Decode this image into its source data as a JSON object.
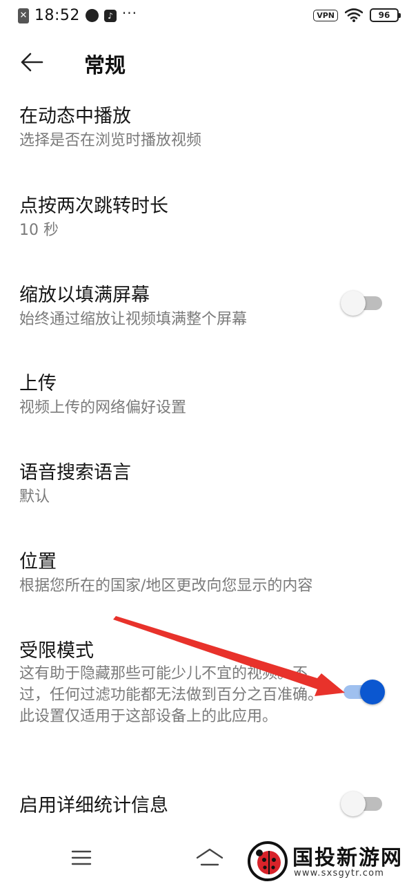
{
  "status_bar": {
    "notif_icon": "x-badge-icon",
    "time": "18:52",
    "more": "···",
    "vpn": "VPN",
    "battery": "96"
  },
  "header": {
    "back_icon": "arrow-left-icon",
    "title": "常规"
  },
  "settings": [
    {
      "title": "在动态中播放",
      "subtitle": "选择是否在浏览时播放视频",
      "toggle": null
    },
    {
      "title": "点按两次跳转时长",
      "subtitle": "10 秒",
      "toggle": null
    },
    {
      "title": "缩放以填满屏幕",
      "subtitle": "始终通过缩放让视频填满整个屏幕",
      "toggle": "off"
    },
    {
      "title": "上传",
      "subtitle": "视频上传的网络偏好设置",
      "toggle": null
    },
    {
      "title": "语音搜索语言",
      "subtitle": "默认",
      "toggle": null
    },
    {
      "title": "位置",
      "subtitle": "根据您所在的国家/地区更改向您显示的内容",
      "toggle": null
    },
    {
      "title": "受限模式",
      "subtitle": "这有助于隐藏那些可能少儿不宜的视频。不过，任何过滤功能都无法做到百分之百准确。此设置仅适用于这部设备上的此应用。",
      "toggle": "on"
    },
    {
      "title": "启用详细统计信息",
      "subtitle": "",
      "toggle": "off"
    }
  ],
  "colors": {
    "accent": "#0b57d0",
    "annotation": "#e8322b"
  },
  "watermark": {
    "text": "国投新游网",
    "url": "www.sxsgytr.com"
  }
}
